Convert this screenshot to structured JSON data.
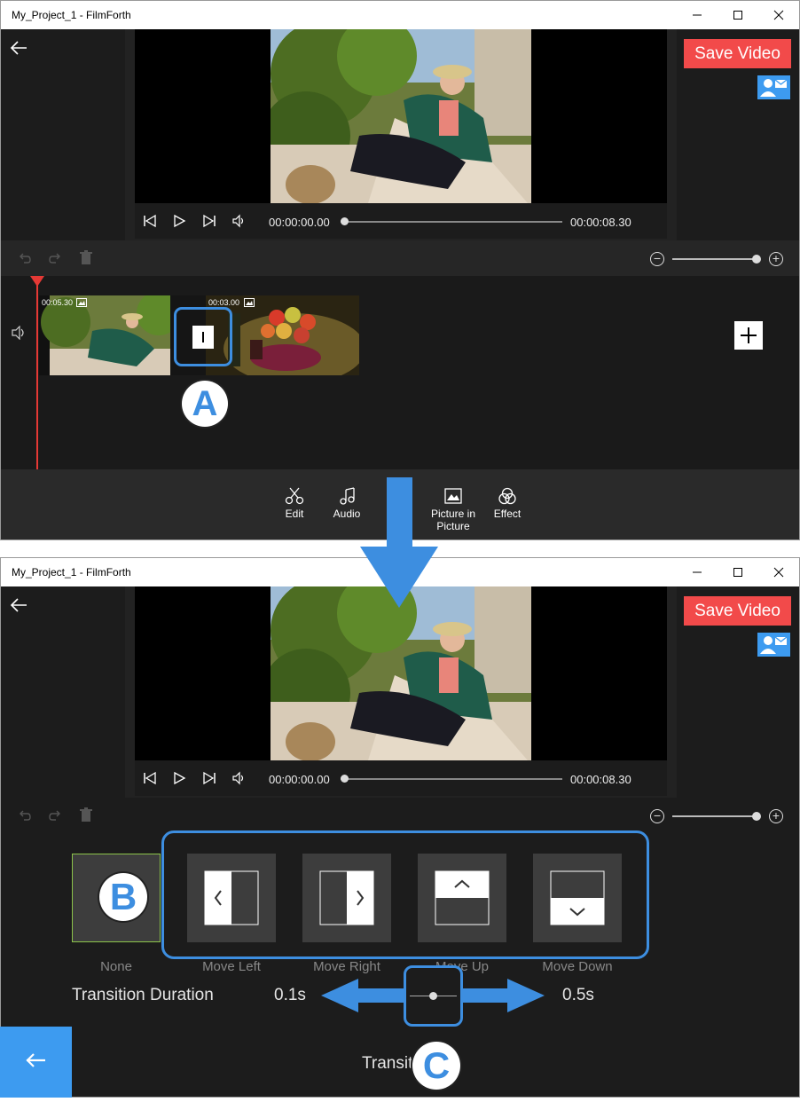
{
  "window_title": "My_Project_1 - FilmForth",
  "save_video_label": "Save Video",
  "player": {
    "current_time": "00:00:00.00",
    "total_time": "00:00:08.30"
  },
  "timeline": {
    "clips": [
      {
        "duration": "00:05.30"
      },
      {
        "duration": "00:03.00"
      }
    ]
  },
  "bottom_tools": [
    {
      "label": "Edit",
      "icon": "scissors-icon"
    },
    {
      "label": "Audio",
      "icon": "music-note-icon"
    },
    {
      "label": "Picture in Picture",
      "icon": "picture-icon"
    },
    {
      "label": "Effect",
      "icon": "effect-circles-icon"
    }
  ],
  "transitions": [
    {
      "label": "None"
    },
    {
      "label": "Move Left"
    },
    {
      "label": "Move Right"
    },
    {
      "label": "Move Up"
    },
    {
      "label": "Move Down"
    }
  ],
  "transition_duration": {
    "label": "Transition Duration",
    "min": "0.1s",
    "max": "0.5s",
    "value_fraction": 0.5
  },
  "bottom_partial_text": "Transit",
  "callouts": {
    "a": "A",
    "b": "B",
    "c": "C"
  },
  "colors": {
    "accent_red": "#f24a4a",
    "accent_blue": "#3d9bf0",
    "highlight_blue": "#3d8ee0",
    "selected_green": "#8bc34a"
  }
}
